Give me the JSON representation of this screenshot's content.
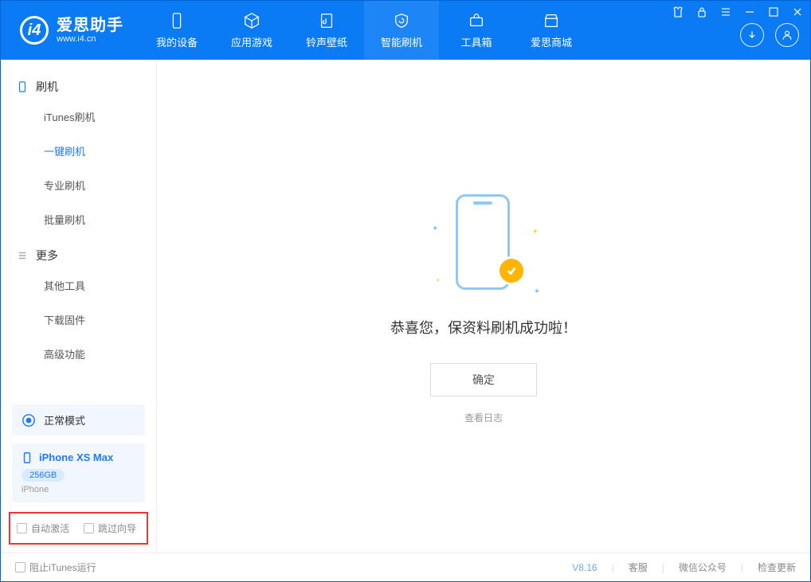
{
  "app": {
    "name": "爱思助手",
    "url": "www.i4.cn"
  },
  "tabs": {
    "device": "我的设备",
    "apps": "应用游戏",
    "ringtone": "铃声壁纸",
    "flash": "智能刷机",
    "toolbox": "工具箱",
    "store": "爱思商城"
  },
  "sidebar": {
    "group_flash": "刷机",
    "items_flash": {
      "itunes": "iTunes刷机",
      "oneclick": "一键刷机",
      "pro": "专业刷机",
      "batch": "批量刷机"
    },
    "group_more": "更多",
    "items_more": {
      "other": "其他工具",
      "firmware": "下载固件",
      "advanced": "高级功能"
    }
  },
  "mode": {
    "label": "正常模式"
  },
  "device": {
    "name": "iPhone XS Max",
    "storage": "256GB",
    "type": "iPhone"
  },
  "options": {
    "auto_activate": "自动激活",
    "skip_guide": "跳过向导"
  },
  "main": {
    "success_msg": "恭喜您，保资料刷机成功啦！",
    "ok": "确定",
    "view_log": "查看日志"
  },
  "status": {
    "block_itunes": "阻止iTunes运行",
    "version": "V8.16",
    "support": "客服",
    "wechat": "微信公众号",
    "update": "检查更新"
  }
}
